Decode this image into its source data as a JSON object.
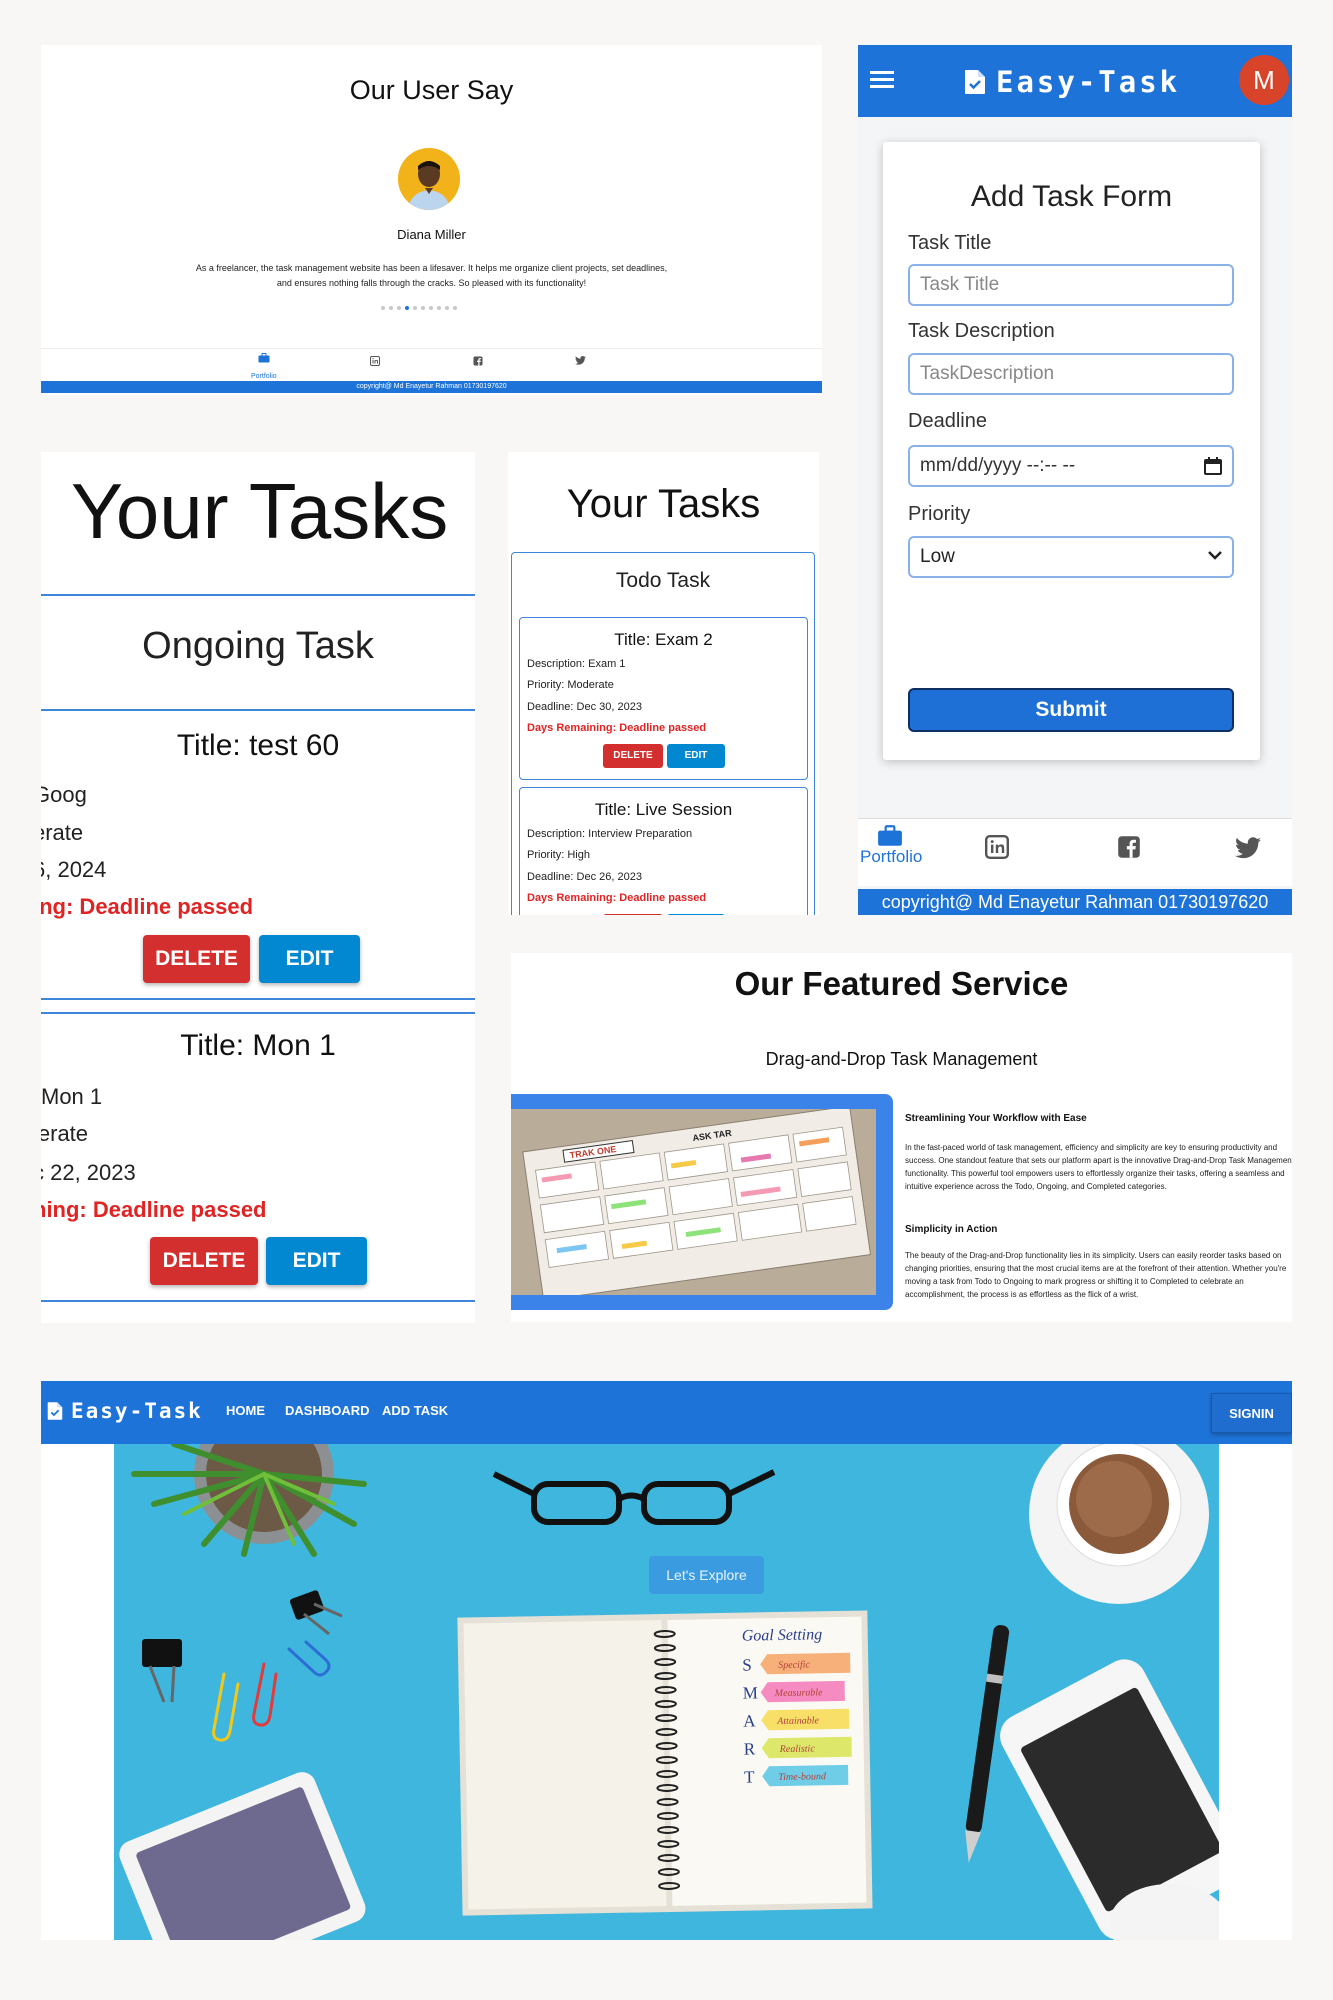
{
  "testimonials": {
    "title": "Our User Say",
    "name": "Diana Miller",
    "quote_line1": "As a freelancer, the task management website has been a lifesaver. It helps me organize client projects, set deadlines,",
    "quote_line2": "and ensures nothing falls through the cracks. So pleased with its functionality!",
    "nav_portfolio": "Portfolio",
    "copyright": "copyright@ Md Enayetur Rahman 01730197620"
  },
  "mobile_form": {
    "brand": "Easy-Task",
    "avatar_letter": "M",
    "form_title": "Add Task Form",
    "task_title_label": "Task Title",
    "task_title_placeholder": "Task Title",
    "task_description_label": "Task Description",
    "task_description_placeholder": "TaskDescription",
    "deadline_label": "Deadline",
    "deadline_placeholder": "mm/dd/yyyy --:-- --",
    "priority_label": "Priority",
    "priority_value": "Low",
    "submit_label": "Submit",
    "nav_portfolio": "Portfolio",
    "copyright": "copyright@ Md Enayetur Rahman 01730197620"
  },
  "tasks_zoom": {
    "title": "Your Tasks",
    "section": "Ongoing Task",
    "task1": {
      "title": "Title: test 60",
      "line1": "Goog",
      "line2": "erate",
      "line3": "6, 2024",
      "line4": "ing: Deadline passed"
    },
    "task2": {
      "title": "Title: Mon 1",
      "line1": "Mon 1",
      "line2": "lerate",
      "line3": "c 22, 2023",
      "line4": "ning: Deadline passed"
    },
    "delete_label": "DELETE",
    "edit_label": "EDIT"
  },
  "tasks_small": {
    "title": "Your Tasks",
    "section": "Todo Task",
    "task1": {
      "title": "Title: Exam 2",
      "description": "Description: Exam 1",
      "priority": "Priority: Moderate",
      "deadline": "Deadline: Dec 30, 2023",
      "remaining": "Days Remaining: Deadline passed"
    },
    "task2": {
      "title": "Title: Live Session",
      "description": "Description: Interview Preparation",
      "priority": "Priority: High",
      "deadline": "Deadline: Dec 26, 2023",
      "remaining": "Days Remaining: Deadline passed"
    },
    "delete_label": "DELETE",
    "edit_label": "EDIT"
  },
  "featured": {
    "title": "Our Featured Service",
    "subtitle": "Drag-and-Drop Task Management",
    "img_text1": "TRAK ONE",
    "img_text2": "ASK TAR",
    "heading1": "Streamlining Your Workflow with Ease",
    "para1": "In the fast-paced world of task management, efficiency and simplicity are key to ensuring productivity and success. One standout feature that sets our platform apart is the innovative Drag-and-Drop Task Management functionality. This powerful tool empowers users to effortlessly organize their tasks, offering a seamless and intuitive experience across the Todo, Ongoing, and Completed categories.",
    "heading2": "Simplicity in Action",
    "para2": "The beauty of the Drag-and-Drop functionality lies in its simplicity. Users can easily reorder tasks based on changing priorities, ensuring that the most crucial items are at the forefront of their attention. Whether you're moving a task from Todo to Ongoing to mark progress or shifting it to Completed to celebrate an accomplishment, the process is as effortless as the flick of a wrist."
  },
  "hero": {
    "brand": "Easy-Task",
    "nav": [
      "HOME",
      "DASHBOARD",
      "ADD TASK"
    ],
    "signin": "SIGNIN",
    "explore": "Let's Explore",
    "notebook": {
      "heading": "Goal Setting",
      "letters": [
        "S",
        "M",
        "A",
        "R",
        "T"
      ],
      "words": [
        "Specific",
        "Measurable",
        "Attainable",
        "Realistic",
        "Time-bound"
      ]
    }
  },
  "colors": {
    "primary": "#1e73d8",
    "danger": "#d32f2f",
    "edit": "#0288d1",
    "deadline_text": "#e02424",
    "hero_bg": "#3fb6dd"
  }
}
